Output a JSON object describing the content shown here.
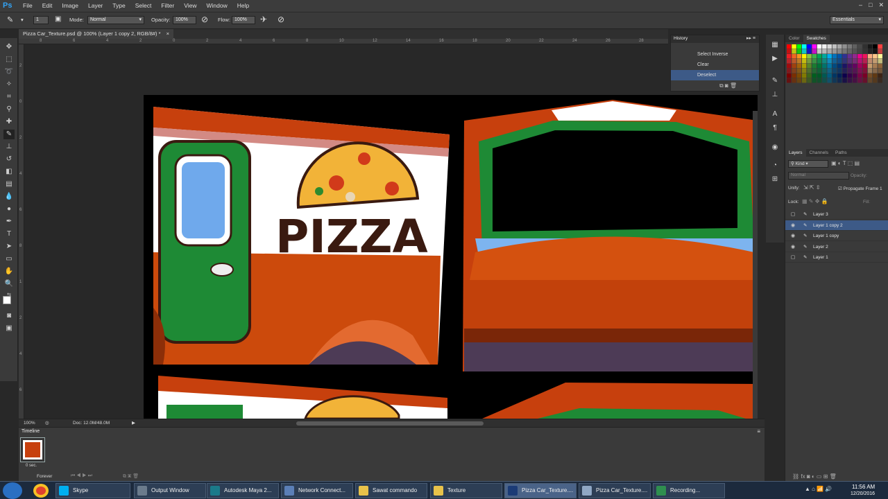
{
  "app": {
    "logo": "Ps"
  },
  "menu": [
    "File",
    "Edit",
    "Image",
    "Layer",
    "Type",
    "Select",
    "Filter",
    "View",
    "Window",
    "Help"
  ],
  "window_controls": [
    "–",
    "□",
    "✕"
  ],
  "options": {
    "brush_size": "1",
    "mode_label": "Mode:",
    "mode_value": "Normal",
    "opacity_label": "Opacity:",
    "opacity_value": "100%",
    "flow_label": "Flow:",
    "flow_value": "100%",
    "workspace": "Essentials"
  },
  "document": {
    "tab_title": "Pizza Car_Texture.psd @ 100% (Layer 1 copy 2, RGB/8#) *",
    "zoom": "100%",
    "doc_size": "Doc: 12.0M/48.0M",
    "artwork_text": "PIZZA"
  },
  "rulers": {
    "h": [
      "8",
      "6",
      "4",
      "2",
      "0",
      "2",
      "4",
      "6",
      "8",
      "10",
      "12",
      "14",
      "16",
      "18",
      "20",
      "22",
      "24",
      "26",
      "28",
      "30"
    ],
    "v": [
      "2",
      "0",
      "2",
      "4",
      "6",
      "8",
      "1",
      "2",
      "4",
      "6"
    ]
  },
  "history": {
    "title": "History",
    "items": [
      "Select Inverse",
      "Clear",
      "Deselect"
    ]
  },
  "color_panel": {
    "tabs": [
      "Color",
      "Swatches"
    ]
  },
  "layers_panel": {
    "tabs": [
      "Layers",
      "Channels",
      "Paths"
    ],
    "kind": "Kind",
    "blend": "Normal",
    "opacity_label": "Opacity:",
    "unify_label": "Unify:",
    "propagate": "Propagate Frame 1",
    "lock_label": "Lock:",
    "fill_label": "Fill:",
    "layers": [
      {
        "name": "Layer 3",
        "visible": false,
        "selected": false
      },
      {
        "name": "Layer 1 copy 2",
        "visible": true,
        "selected": true
      },
      {
        "name": "Layer 1 copy",
        "visible": true,
        "selected": false
      },
      {
        "name": "Layer 2",
        "visible": true,
        "selected": false
      },
      {
        "name": "Layer 1",
        "visible": false,
        "selected": false
      }
    ]
  },
  "timeline": {
    "title": "Timeline",
    "frame_delay": "0 sec.",
    "loop": "Forever"
  },
  "taskbar": {
    "items": [
      "Skype",
      "Output Window",
      "Autodesk Maya 2...",
      "Network Connect...",
      "Sawat commando",
      "Texture",
      "Pizza Car_Texture....",
      "Pizza Car_Texture....",
      "Recording..."
    ],
    "time": "11:56 AM",
    "date": "12/20/2016"
  },
  "colors": {
    "ui_dark": "#282828",
    "panel": "#3a3a3a",
    "ps_blue": "#33a3f4",
    "car_red": "#c7400d",
    "car_green": "#1e8a35",
    "selection": "#3d5a87"
  }
}
